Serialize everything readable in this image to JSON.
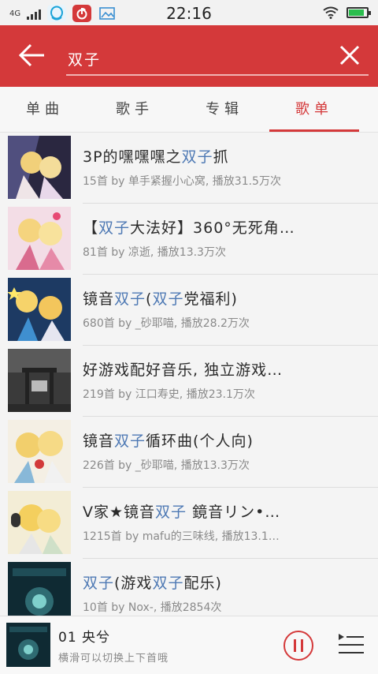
{
  "status_bar": {
    "network": "4G",
    "time": "22:16",
    "icons": [
      "signal-icon",
      "qq-icon",
      "netease-music-icon",
      "gallery-icon",
      "wifi-icon",
      "battery-icon"
    ],
    "battery_level": 0.85
  },
  "search": {
    "value": "双子",
    "back_icon": "back-arrow-icon",
    "clear_icon": "close-icon"
  },
  "tabs": [
    {
      "label": "单曲",
      "active": false
    },
    {
      "label": "歌手",
      "active": false
    },
    {
      "label": "专辑",
      "active": false
    },
    {
      "label": "歌单",
      "active": true
    }
  ],
  "playlists": [
    {
      "title_parts": [
        {
          "t": "3P的嘿嘿嘿之",
          "h": false
        },
        {
          "t": "双子",
          "h": true
        },
        {
          "t": "抓",
          "h": false
        }
      ],
      "subtitle": "15首  by 单手紧握小心窝, 播放31.5万次"
    },
    {
      "title_parts": [
        {
          "t": "【",
          "h": false
        },
        {
          "t": "双子",
          "h": true
        },
        {
          "t": "大法好】360°无死角…",
          "h": false
        }
      ],
      "subtitle": "81首  by 凉逝, 播放13.3万次"
    },
    {
      "title_parts": [
        {
          "t": "镜音",
          "h": false
        },
        {
          "t": "双子",
          "h": true
        },
        {
          "t": "(",
          "h": false
        },
        {
          "t": "双子",
          "h": true
        },
        {
          "t": "党福利)",
          "h": false
        }
      ],
      "subtitle": "680首  by _砂耶喵, 播放28.2万次"
    },
    {
      "title_parts": [
        {
          "t": "好游戏配好音乐, 独立游戏…",
          "h": false
        }
      ],
      "subtitle": "219首  by 江口寿史, 播放23.1万次"
    },
    {
      "title_parts": [
        {
          "t": "镜音",
          "h": false
        },
        {
          "t": "双子",
          "h": true
        },
        {
          "t": "循环曲(个人向)",
          "h": false
        }
      ],
      "subtitle": "226首  by _砂耶喵, 播放13.3万次"
    },
    {
      "title_parts": [
        {
          "t": "V家★镜音",
          "h": false
        },
        {
          "t": "双子",
          "h": true
        },
        {
          "t": " 鏡音リン•…",
          "h": false
        }
      ],
      "subtitle": "1215首  by mafu的三味线, 播放13.1…"
    },
    {
      "title_parts": [
        {
          "t": "双子",
          "h": true
        },
        {
          "t": "(游戏",
          "h": false
        },
        {
          "t": "双子",
          "h": true
        },
        {
          "t": "配乐)",
          "h": false
        }
      ],
      "subtitle": "10首  by Nox-, 播放2854次"
    }
  ],
  "player": {
    "title": "01 央兮",
    "hint": "横滑可以切换上下首哦",
    "play_icon": "pause-icon",
    "queue_icon": "playlist-icon"
  },
  "colors": {
    "accent": "#d4393a",
    "highlight": "#4e79b4"
  }
}
